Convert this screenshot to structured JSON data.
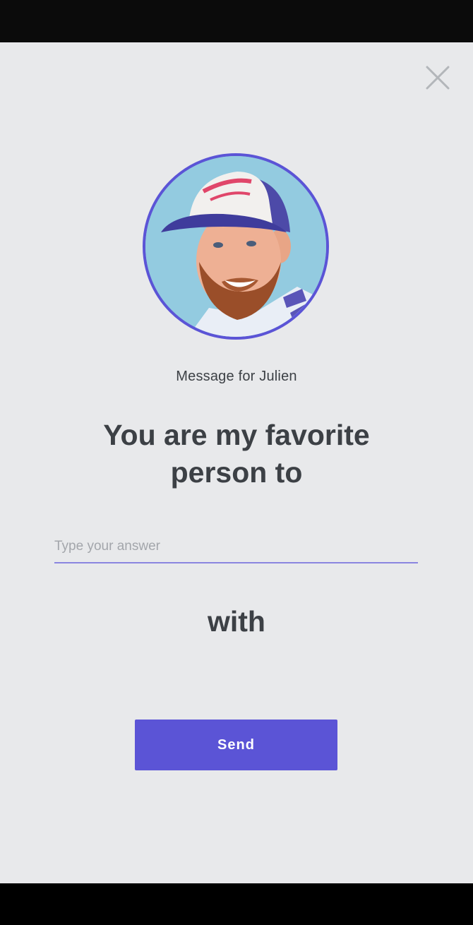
{
  "message": {
    "recipient_label": "Message for Julien",
    "prompt": "You are my favorite person to",
    "suffix": "with"
  },
  "answer": {
    "value": "",
    "placeholder": "Type your answer"
  },
  "actions": {
    "send_label": "Send",
    "close_icon": "close-icon"
  },
  "avatar": {
    "alt": "Julien"
  },
  "colors": {
    "accent": "#5b54d6",
    "background": "#e8e9eb",
    "text": "#3c4045",
    "placeholder": "#a3a6ab"
  }
}
